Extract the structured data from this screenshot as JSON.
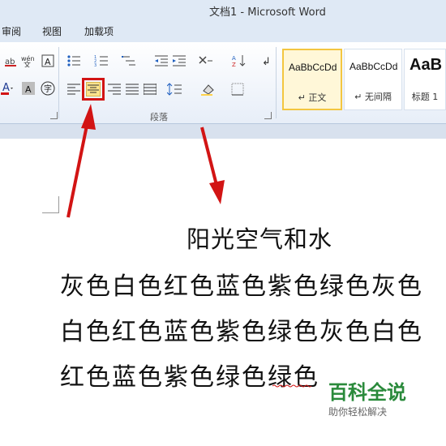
{
  "window": {
    "title": "文档1 - Microsoft Word"
  },
  "tabs": [
    "审阅",
    "视图",
    "加载项"
  ],
  "ribbon": {
    "paragraph_group_label": "段落",
    "styles": [
      {
        "sample": "AaBbCcDd",
        "name": "↵ 正文",
        "active": true
      },
      {
        "sample": "AaBbCcDd",
        "name": "↵ 无间隔",
        "active": false
      },
      {
        "sample": "AaB",
        "name": "标题 1",
        "active": false
      }
    ]
  },
  "document": {
    "title": "阳光空气和水",
    "lines": [
      "灰色白色红色蓝色紫色绿色灰色",
      "白色红色蓝色紫色绿色灰色白色",
      "红色蓝色紫色绿色绿色"
    ]
  },
  "watermark": {
    "brand": "百科全说",
    "slogan": "助你轻松解决"
  },
  "colors": {
    "highlight": "#d21414",
    "arrow": "#d21414",
    "brand": "#2a8a3b"
  },
  "icons": [
    "bullets-icon",
    "numbering-icon",
    "multilevel-list-icon",
    "decrease-indent-icon",
    "increase-indent-icon",
    "chinese-layout-icon",
    "sort-icon",
    "show-marks-icon",
    "align-left-icon",
    "align-center-icon",
    "align-right-icon",
    "justify-icon",
    "distributed-icon",
    "line-spacing-icon",
    "shading-icon",
    "borders-icon"
  ]
}
